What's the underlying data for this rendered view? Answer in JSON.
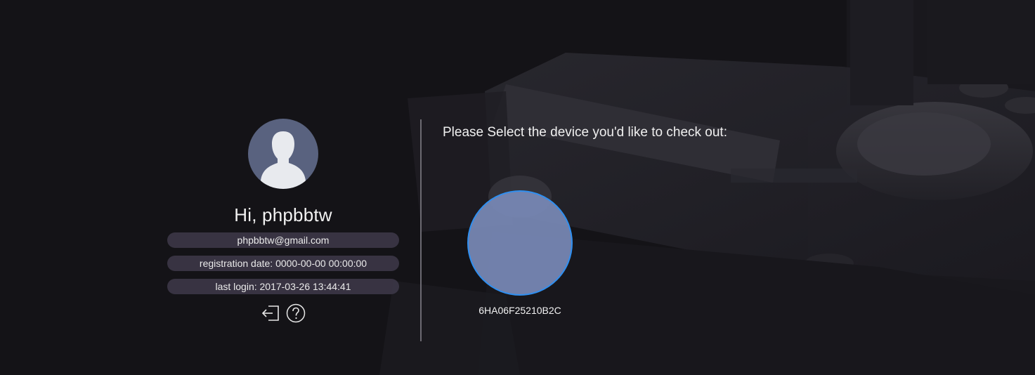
{
  "colors": {
    "background": "#141317",
    "avatar": "#59627f",
    "pill": "#3e3a4a",
    "device_fill": "#7889b6",
    "device_border": "#2f8ff0"
  },
  "profile": {
    "avatar_icon": "user-silhouette-icon",
    "greeting": "Hi, phpbbtw",
    "email": "phpbbtw@gmail.com",
    "registration": "registration date: 0000-00-00 00:00:00",
    "last_login": "last login: 2017-03-26 13:44:41",
    "actions": {
      "logout_icon": "logout-icon",
      "help_icon": "help-icon"
    }
  },
  "main": {
    "prompt": "Please Select the device you'd like to check out:",
    "devices": [
      {
        "id_label": "6HA06F25210B2C"
      }
    ]
  }
}
